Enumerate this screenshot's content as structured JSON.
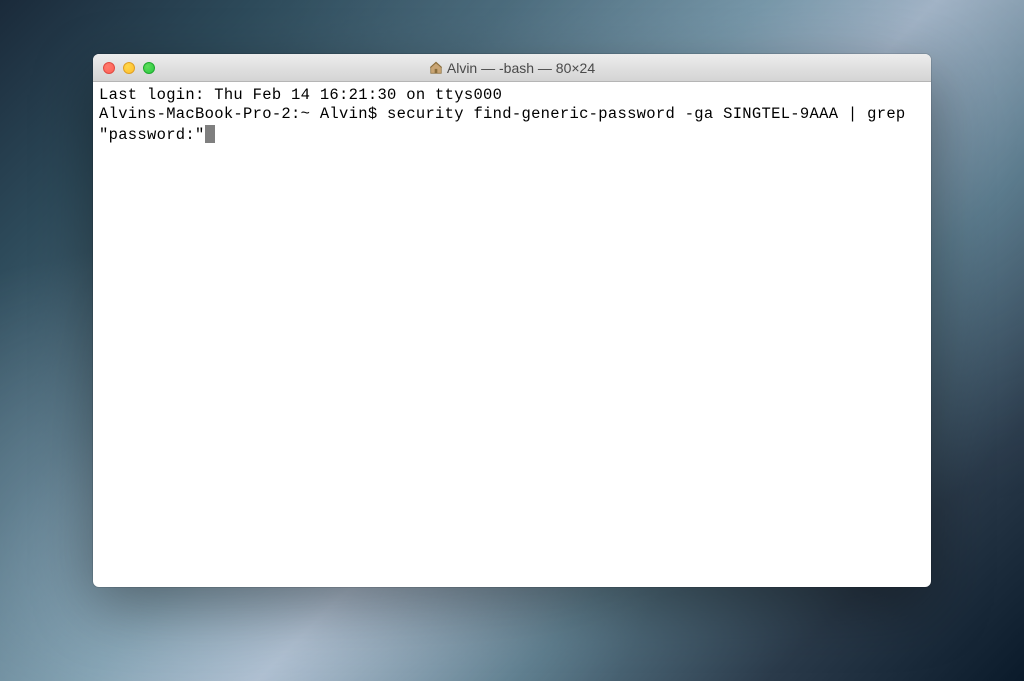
{
  "window": {
    "title": "Alvin — -bash — 80×24"
  },
  "terminal": {
    "last_login": "Last login: Thu Feb 14 16:21:30 on ttys000",
    "prompt": "Alvins-MacBook-Pro-2:~ Alvin$ ",
    "command": "security find-generic-password -ga SINGTEL-9AAA | grep \"password:\""
  }
}
